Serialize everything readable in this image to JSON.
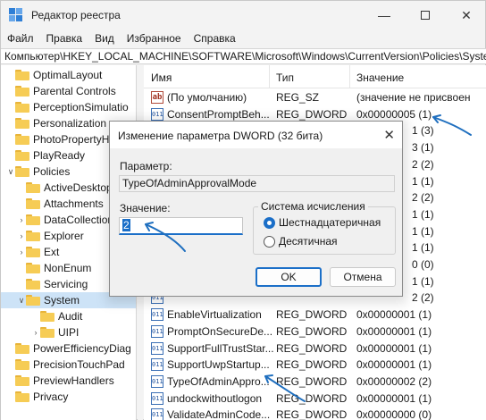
{
  "window": {
    "title": "Редактор реестра"
  },
  "menu": [
    "Файл",
    "Правка",
    "Вид",
    "Избранное",
    "Справка"
  ],
  "address": "Компьютер\\HKEY_LOCAL_MACHINE\\SOFTWARE\\Microsoft\\Windows\\CurrentVersion\\Policies\\System",
  "tree": [
    {
      "label": "OptimalLayout",
      "level": 0
    },
    {
      "label": "Parental Controls",
      "level": 0
    },
    {
      "label": "PerceptionSimulatio",
      "level": 0
    },
    {
      "label": "Personalization",
      "level": 0
    },
    {
      "label": "PhotoPropertyHa",
      "level": 0
    },
    {
      "label": "PlayReady",
      "level": 0
    },
    {
      "label": "Policies",
      "level": 0
    },
    {
      "label": "ActiveDesktop",
      "level": 1
    },
    {
      "label": "Attachments",
      "level": 1
    },
    {
      "label": "DataCollection",
      "level": 1
    },
    {
      "label": "Explorer",
      "level": 1
    },
    {
      "label": "Ext",
      "level": 1
    },
    {
      "label": "NonEnum",
      "level": 1
    },
    {
      "label": "Servicing",
      "level": 1
    },
    {
      "label": "System",
      "level": 1
    },
    {
      "label": "Audit",
      "level": 2
    },
    {
      "label": "UIPI",
      "level": 2
    },
    {
      "label": "PowerEfficiencyDiag",
      "level": 0
    },
    {
      "label": "PrecisionTouchPad",
      "level": 0
    },
    {
      "label": "PreviewHandlers",
      "level": 0
    },
    {
      "label": "Privacy",
      "level": 0
    }
  ],
  "columns": {
    "name": "Имя",
    "type": "Тип",
    "value": "Значение"
  },
  "values": [
    {
      "name": "(По умолчанию)",
      "type": "REG_SZ",
      "value": "(значение не присвоен",
      "icon": "ab"
    },
    {
      "name": "ConsentPromptBeh...",
      "type": "REG_DWORD",
      "value": "0x00000005 (1)",
      "icon": "dw"
    },
    {
      "name": "",
      "type": "",
      "value": "1 (3)",
      "icon": "dw"
    },
    {
      "name": "",
      "type": "",
      "value": "3 (1)",
      "icon": "dw"
    },
    {
      "name": "",
      "type": "",
      "value": "2 (2)",
      "icon": "dw"
    },
    {
      "name": "",
      "type": "",
      "value": "1 (1)",
      "icon": "dw"
    },
    {
      "name": "",
      "type": "",
      "value": "2 (2)",
      "icon": "dw"
    },
    {
      "name": "",
      "type": "",
      "value": "1 (1)",
      "icon": "dw"
    },
    {
      "name": "",
      "type": "",
      "value": "1 (1)",
      "icon": "dw"
    },
    {
      "name": "",
      "type": "",
      "value": "1 (1)",
      "icon": "dw"
    },
    {
      "name": "",
      "type": "",
      "value": "0 (0)",
      "icon": "dw"
    },
    {
      "name": "",
      "type": "",
      "value": "1 (1)",
      "icon": "dw"
    },
    {
      "name": "",
      "type": "",
      "value": "2 (2)",
      "icon": "dw"
    },
    {
      "name": "EnableVirtualization",
      "type": "REG_DWORD",
      "value": "0x00000001 (1)",
      "icon": "dw"
    },
    {
      "name": "PromptOnSecureDe...",
      "type": "REG_DWORD",
      "value": "0x00000001 (1)",
      "icon": "dw"
    },
    {
      "name": "SupportFullTrustStar...",
      "type": "REG_DWORD",
      "value": "0x00000001 (1)",
      "icon": "dw"
    },
    {
      "name": "SupportUwpStartup...",
      "type": "REG_DWORD",
      "value": "0x00000001 (1)",
      "icon": "dw"
    },
    {
      "name": "TypeOfAdminAppro...",
      "type": "REG_DWORD",
      "value": "0x00000002 (2)",
      "icon": "dw"
    },
    {
      "name": "undockwithoutlogon",
      "type": "REG_DWORD",
      "value": "0x00000001 (1)",
      "icon": "dw"
    },
    {
      "name": "ValidateAdminCode...",
      "type": "REG_DWORD",
      "value": "0x00000000 (0)",
      "icon": "dw"
    }
  ],
  "dialog": {
    "title": "Изменение параметра DWORD (32 бита)",
    "param_label": "Параметр:",
    "param_value": "TypeOfAdminApprovalMode",
    "value_label": "Значение:",
    "value": "2",
    "base_label": "Система исчисления",
    "hex_label": "Шестнадцатеричная",
    "dec_label": "Десятичная",
    "ok": "OK",
    "cancel": "Отмена"
  },
  "accent": "#1b6fc8"
}
